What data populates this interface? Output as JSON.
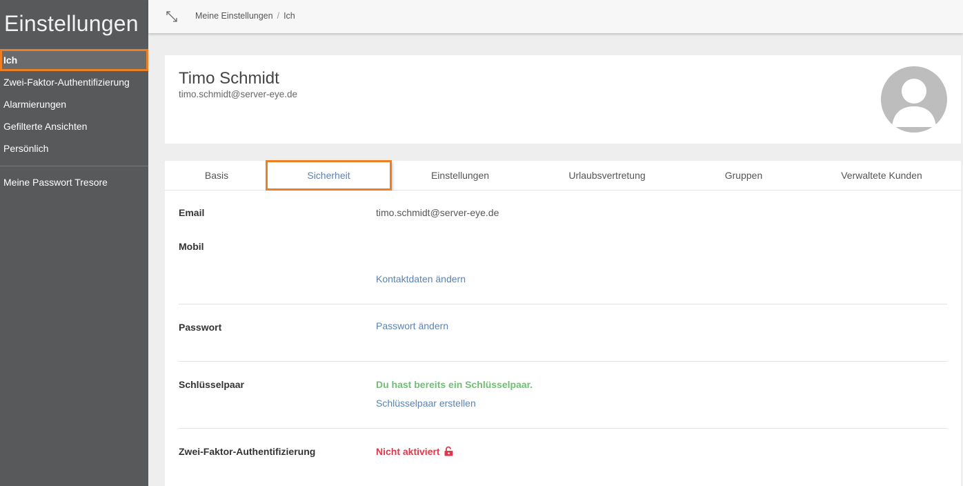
{
  "sidebar": {
    "title": "Einstellungen",
    "items": [
      {
        "label": "Ich"
      },
      {
        "label": "Zwei-Faktor-Authentifizierung"
      },
      {
        "label": "Alarmierungen"
      },
      {
        "label": "Gefilterte Ansichten"
      },
      {
        "label": "Persönlich"
      },
      {
        "label": "Meine Passwort Tresore"
      }
    ]
  },
  "breadcrumb": {
    "items": [
      "Meine Einstellungen",
      "Ich"
    ],
    "separator": "/"
  },
  "profile": {
    "name": "Timo Schmidt",
    "email": "timo.schmidt@server-eye.de"
  },
  "tabs": [
    {
      "label": "Basis"
    },
    {
      "label": "Sicherheit"
    },
    {
      "label": "Einstellungen"
    },
    {
      "label": "Urlaubsvertretung"
    },
    {
      "label": "Gruppen"
    },
    {
      "label": "Verwaltete Kunden"
    }
  ],
  "security": {
    "email_label": "Email",
    "email_value": "timo.schmidt@server-eye.de",
    "mobile_label": "Mobil",
    "contact_link": "Kontaktdaten ändern",
    "password_label": "Passwort",
    "password_link": "Passwort ändern",
    "keypair_label": "Schlüsselpaar",
    "keypair_status": "Du hast bereits ein Schlüsselpaar.",
    "keypair_link": "Schlüsselpaar erstellen",
    "twofa_label": "Zwei-Faktor-Authentifizierung",
    "twofa_status": "Nicht aktiviert"
  },
  "colors": {
    "accent_highlight": "#ef7d22",
    "link": "#5b82b0",
    "success": "#6fbf73",
    "danger": "#e0384a",
    "sidebar_bg": "#58595b"
  },
  "icons": {
    "expand": "expand-icon",
    "lock": "lock-open-icon",
    "avatar": "user-avatar-icon"
  }
}
